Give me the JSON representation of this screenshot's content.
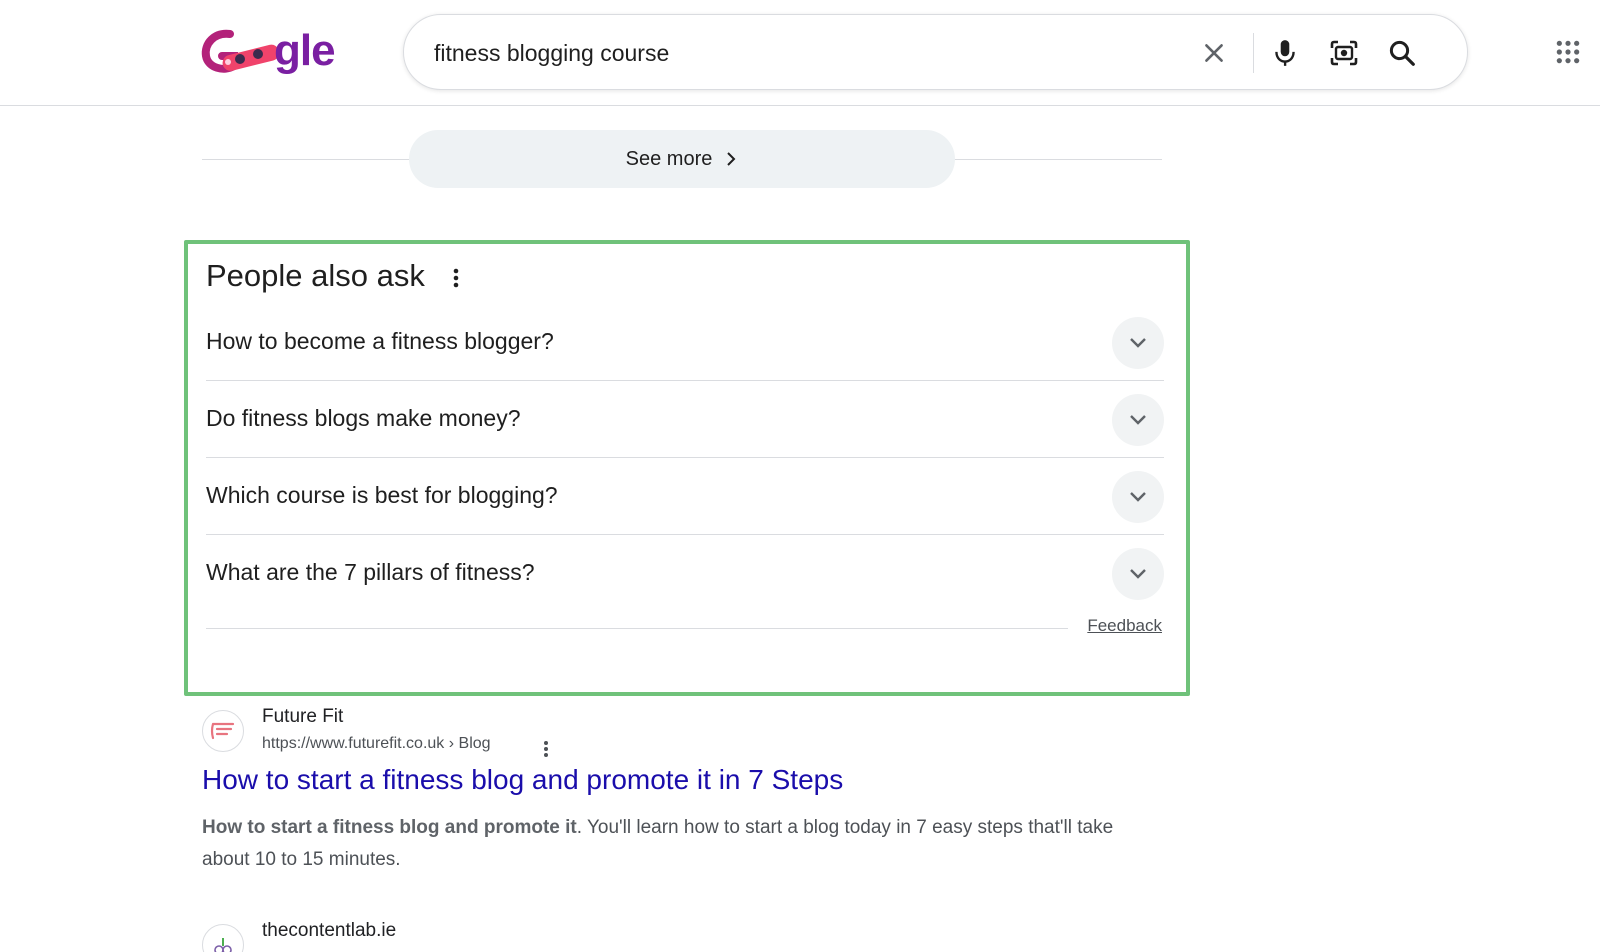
{
  "header": {
    "logo_text": "gle",
    "search_value": "fitness blogging course",
    "icons": [
      "clear-icon",
      "microphone-icon",
      "camera-lens-icon",
      "search-icon",
      "apps-grid-icon"
    ]
  },
  "see_more": {
    "label": "See more"
  },
  "people_also_ask": {
    "title": "People also ask",
    "questions": [
      "How to become a fitness blogger?",
      "Do fitness blogs make money?",
      "Which course is best for blogging?",
      "What are the 7 pillars of fitness?"
    ],
    "feedback_label": "Feedback",
    "highlight_color": "#6fc27a"
  },
  "results": [
    {
      "site_name": "Future Fit",
      "url": "https://www.futurefit.co.uk › Blog",
      "title": "How to start a fitness blog and promote it in 7 Steps",
      "snippet_bold": "How to start a fitness blog and promote it",
      "snippet_rest": ". You'll learn how to start a blog today in 7 easy steps that'll take about 10 to 15 minutes."
    },
    {
      "site_name": "thecontentlab.ie"
    }
  ],
  "colors": {
    "link": "#1a0dab",
    "text": "#1f1f1f",
    "muted": "#4d5156",
    "logo": "#7a1fa2"
  }
}
